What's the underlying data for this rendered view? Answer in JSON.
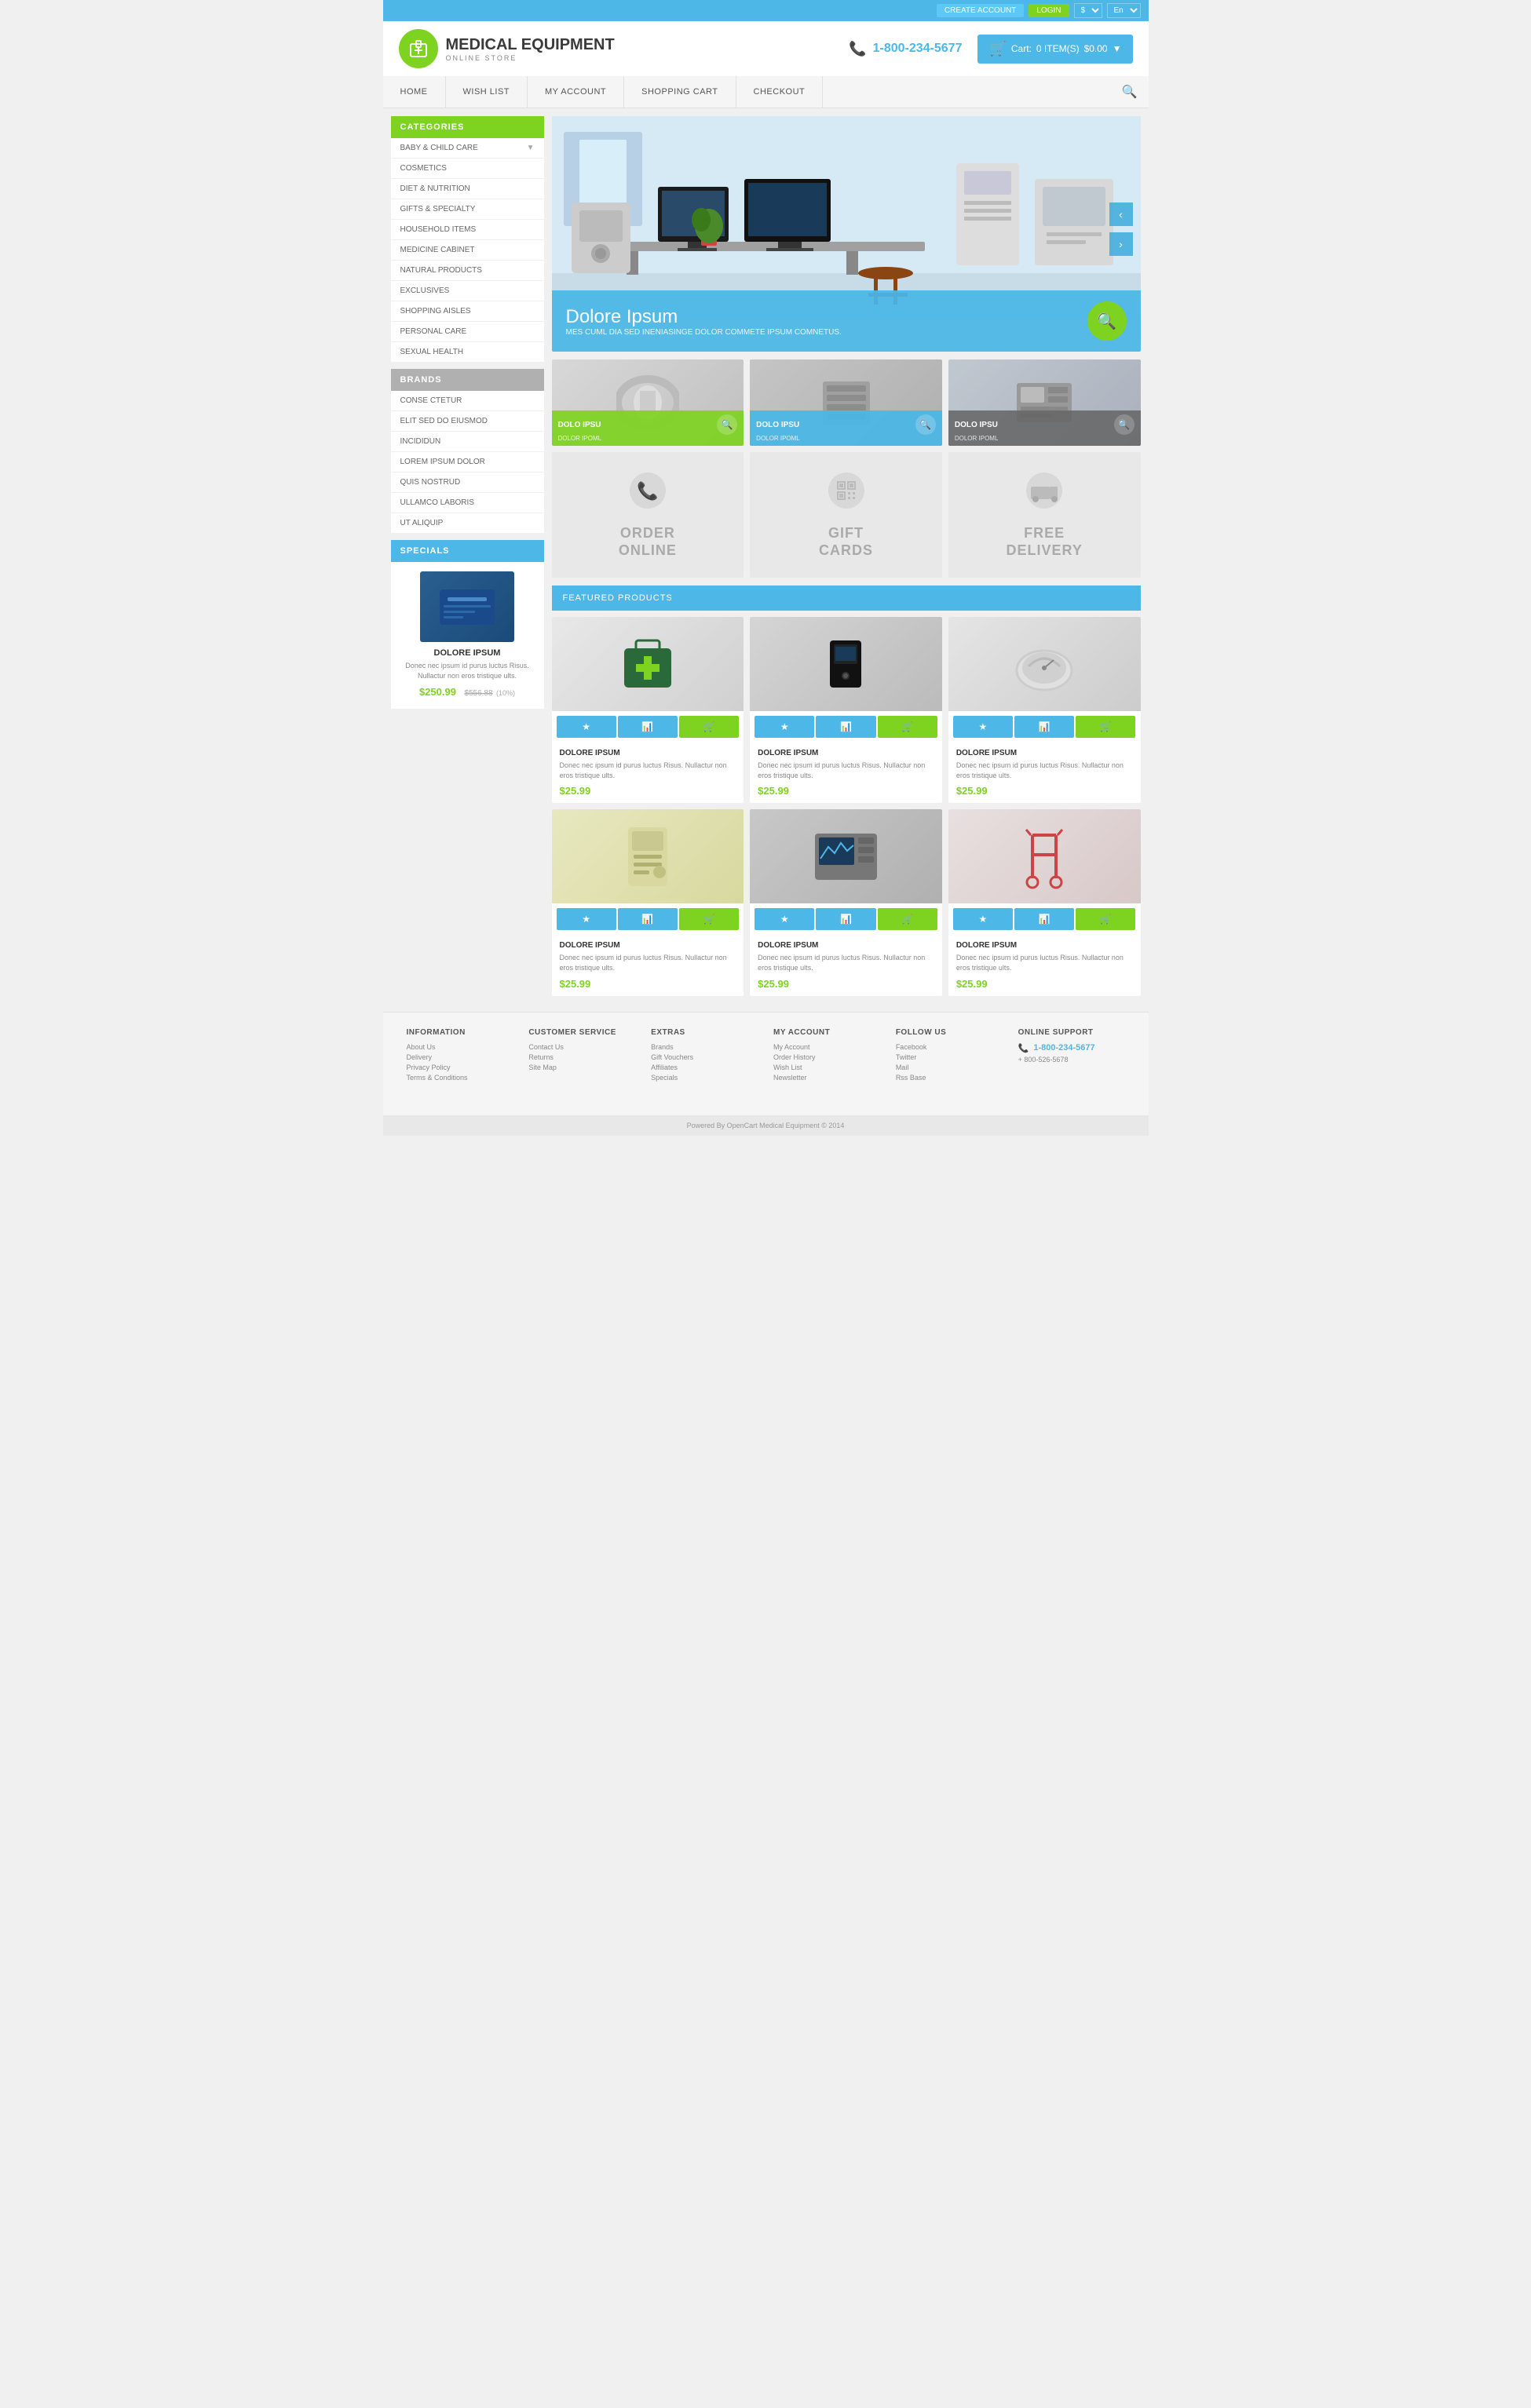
{
  "topBar": {
    "createAccount": "CREATE ACCOUNT",
    "login": "LOGIN",
    "currency": "$",
    "language": "En"
  },
  "header": {
    "logoTitle": "MEDICAL EQUIPMENT",
    "logoSubtitle": "ONLINE STORE",
    "phone": "1-800-234-5677",
    "cartLabel": "Cart:",
    "cartItems": "0 ITEM(S)",
    "cartTotal": "$0.00"
  },
  "nav": {
    "items": [
      {
        "label": "HOME"
      },
      {
        "label": "WISH LIST"
      },
      {
        "label": "MY ACCOUNT"
      },
      {
        "label": "SHOPPING CART"
      },
      {
        "label": "CHECKOUT"
      }
    ]
  },
  "hero": {
    "title": "Dolore Ipsum",
    "subtitle": "MES CUML DIA SED INENIASINGE DOLOR COMMETE IPSUM COMNETUS."
  },
  "sidebar": {
    "categoriesTitle": "CATEGORIES",
    "categories": [
      {
        "label": "BABY & CHILD CARE",
        "hasDropdown": true
      },
      {
        "label": "COSMETICS",
        "hasDropdown": false
      },
      {
        "label": "DIET & NUTRITION",
        "hasDropdown": false
      },
      {
        "label": "GIFTS & SPECIALTY",
        "hasDropdown": false
      },
      {
        "label": "HOUSEHOLD ITEMS",
        "hasDropdown": false
      },
      {
        "label": "MEDICINE CABINET",
        "hasDropdown": false
      },
      {
        "label": "NATURAL PRODUCTS",
        "hasDropdown": false
      },
      {
        "label": "EXCLUSIVES",
        "hasDropdown": false
      },
      {
        "label": "SHOPPING AISLES",
        "hasDropdown": false
      },
      {
        "label": "PERSONAL CARE",
        "hasDropdown": false
      },
      {
        "label": "SEXUAL HEALTH",
        "hasDropdown": false
      }
    ],
    "brandsTitle": "BRANDS",
    "brands": [
      {
        "label": "CONSE CTETUR"
      },
      {
        "label": "ELIT SED DO EIUSMOD"
      },
      {
        "label": "INCIDIDUN"
      },
      {
        "label": "LOREM IPSUM DOLOR"
      },
      {
        "label": "QUIS NOSTRUD"
      },
      {
        "label": "ULLAMCO LABORIS"
      },
      {
        "label": "UT ALIQUIP"
      }
    ],
    "specialsTitle": "SPECIALS",
    "specialsProduct": {
      "name": "DOLORE IPSUM",
      "desc": "Donec nec ipsum id purus luctus Risus. Nullactur non eros tristique ults.",
      "price": "$250.99",
      "oldPrice": "$556.88",
      "discount": "(10%)"
    }
  },
  "productCards": [
    {
      "name": "DOLO IPSU",
      "sub": "DOLOR IPOML",
      "type": "mri"
    },
    {
      "name": "DOLO IPSU",
      "sub": "DOLOR IPOML",
      "type": "server"
    },
    {
      "name": "DOLO IPSU",
      "sub": "DOLOR IPOML",
      "type": "analyzer"
    }
  ],
  "serviceCards": [
    {
      "icon": "📞",
      "label": "ORDER\nONLINE"
    },
    {
      "icon": "▦",
      "label": "GIFT\nCARDS"
    },
    {
      "icon": "🚚",
      "label": "FREE\nDELIVERY"
    }
  ],
  "featuredTitle": "FEATURED PRODUCTS",
  "featuredProducts": [
    {
      "name": "DOLORE IPSUM",
      "desc": "Donec nec ipsum id purus luctus Risus. Nullactur non eros tristique ults.",
      "price": "$25.99",
      "type": "bag"
    },
    {
      "name": "DOLORE IPSUM",
      "desc": "Donec nec ipsum id purus luctus Risus. Nullactur non eros tristique ults.",
      "price": "$25.99",
      "type": "bp"
    },
    {
      "name": "DOLORE IPSUM",
      "desc": "Donec nec ipsum id purus luctus Risus. Nullactur non eros tristique ults.",
      "price": "$25.99",
      "type": "device"
    },
    {
      "name": "DOLORE IPSUM",
      "desc": "Donec nec ipsum id purus luctus Risus. Nullactur non eros tristique ults.",
      "price": "$25.99",
      "type": "pump"
    },
    {
      "name": "DOLORE IPSUM",
      "desc": "Donec nec ipsum id purus luctus Risus. Nullactur non eros tristique ults.",
      "price": "$25.99",
      "type": "analyzer2"
    },
    {
      "name": "DOLORE IPSUM",
      "desc": "Donec nec ipsum id purus luctus Risus. Nullactur non eros tristique ults.",
      "price": "$25.99",
      "type": "walker"
    }
  ],
  "footer": {
    "columns": [
      {
        "title": "INFORMATION",
        "links": [
          "About Us",
          "Delivery",
          "Privacy Policy",
          "Terms & Conditions"
        ]
      },
      {
        "title": "CUSTOMER SERVICE",
        "links": [
          "Contact Us",
          "Returns",
          "Site Map"
        ]
      },
      {
        "title": "EXTRAS",
        "links": [
          "Brands",
          "Gift Vouchers",
          "Affiliates",
          "Specials"
        ]
      },
      {
        "title": "MY ACCOUNT",
        "links": [
          "My Account",
          "Order History",
          "Wish List",
          "Newsletter"
        ]
      },
      {
        "title": "FOLLOW US",
        "links": [
          "Facebook",
          "Twitter",
          "Mail",
          "Rss Base"
        ]
      },
      {
        "title": "ONLINE SUPPORT",
        "phone1": "1-800-234-5677",
        "phone2": "+ 800-526-5678"
      }
    ],
    "copyright": "Powered By OpenCart Medical Equipment © 2014"
  }
}
